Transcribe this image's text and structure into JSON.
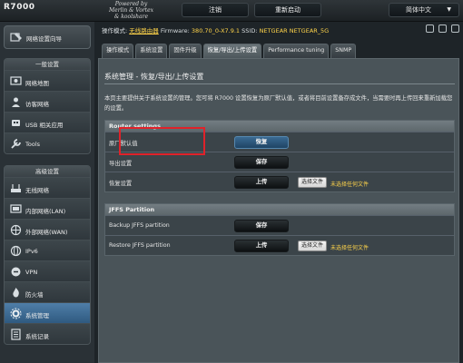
{
  "header": {
    "logo": "R7000",
    "powered_by": [
      "Powered by",
      "Merlin & Vortex",
      "& koolshare"
    ],
    "logout_label": "注销",
    "reboot_label": "重新启动",
    "language": "简体中文",
    "language_arrow": "▼"
  },
  "status": {
    "mode_label": "操作模式:",
    "mode_value": "无线路由器",
    "firmware_label": "Firmware:",
    "firmware_value": "380.70_0-X7.9.1",
    "ssid_label": "SSID:",
    "ssid_values": [
      "NETGEAR",
      "NETGEAR_5G"
    ]
  },
  "sidebar": {
    "quick_setup": "网络设置向导",
    "general_header": "一般设置",
    "general_items": [
      {
        "label": "网络地图",
        "icon": "network-map-icon"
      },
      {
        "label": "访客网络",
        "icon": "guest-network-icon"
      },
      {
        "label": "USB 相关应用",
        "icon": "usb-icon"
      },
      {
        "label": "Tools",
        "icon": "tools-icon"
      }
    ],
    "advanced_header": "高级设置",
    "advanced_items": [
      {
        "label": "无线网络",
        "icon": "wireless-icon"
      },
      {
        "label": "内部网络(LAN)",
        "icon": "lan-icon"
      },
      {
        "label": "外部网络(WAN)",
        "icon": "wan-icon"
      },
      {
        "label": "IPv6",
        "icon": "ipv6-icon"
      },
      {
        "label": "VPN",
        "icon": "vpn-icon"
      },
      {
        "label": "防火墙",
        "icon": "firewall-icon"
      },
      {
        "label": "系统管理",
        "icon": "admin-icon"
      },
      {
        "label": "系统记录",
        "icon": "syslog-icon"
      }
    ]
  },
  "tabs": [
    {
      "label": "操作模式"
    },
    {
      "label": "系统设置"
    },
    {
      "label": "固件升级"
    },
    {
      "label": "恢复/导出/上传设置"
    },
    {
      "label": "Performance tuning"
    },
    {
      "label": "SNMP"
    }
  ],
  "main": {
    "title": "系统管理 - 恢复/导出/上传设置",
    "description": "本页主要提供关于系统设置的管理。您可将 R7000 设置恢复为原厂默认值，或者将目前设置备存成文件，当需要时再上传回来重新加载您的设置。",
    "router_section": {
      "header": "Router settings",
      "rows": [
        {
          "label": "原厂默认值",
          "button": "恢复"
        },
        {
          "label": "导出设置",
          "button": "保存"
        },
        {
          "label": "恢复设置",
          "button": "上传",
          "file_button": "选择文件",
          "file_status": "未选择任何文件"
        }
      ]
    },
    "jffs_section": {
      "header": "JFFS Partition",
      "rows": [
        {
          "label": "Backup JFFS partition",
          "button": "保存"
        },
        {
          "label": "Restore JFFS partition",
          "button": "上传",
          "file_button": "选择文件",
          "file_status": "未选择任何文件"
        }
      ]
    }
  },
  "colors": {
    "highlight_box": "#e0222a",
    "link_yellow": "#ffd44a",
    "active_menu": "#3d6f98"
  }
}
